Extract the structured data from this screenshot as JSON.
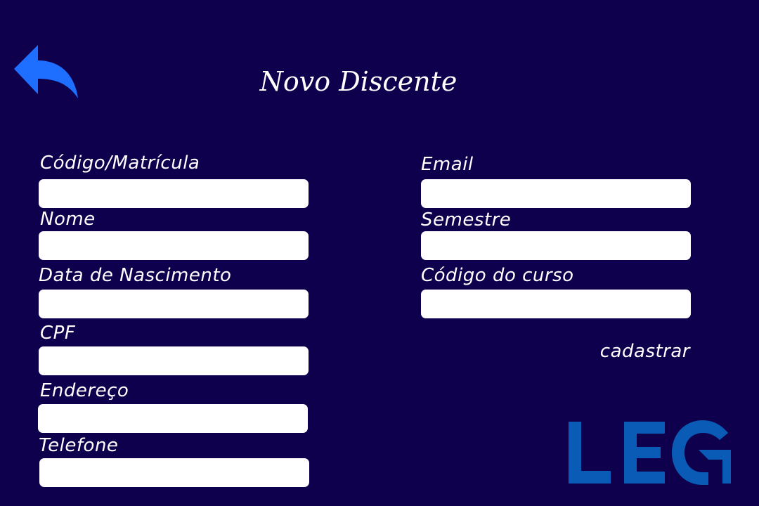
{
  "header": {
    "title": "Novo Discente",
    "back_icon": "back-arrow-icon"
  },
  "form": {
    "left_fields": [
      {
        "label": "Código/Matrícula",
        "value": ""
      },
      {
        "label": "Nome",
        "value": ""
      },
      {
        "label": "Data de Nascimento",
        "value": ""
      },
      {
        "label": "CPF",
        "value": ""
      },
      {
        "label": "Endereço",
        "value": ""
      },
      {
        "label": "Telefone",
        "value": ""
      }
    ],
    "right_fields": [
      {
        "label": "Email",
        "value": ""
      },
      {
        "label": "Semestre",
        "value": ""
      },
      {
        "label": "Código do curso",
        "value": ""
      }
    ],
    "submit_label": "cadastrar"
  },
  "logo": {
    "text": "LEG",
    "color": "#0a5bb5"
  },
  "colors": {
    "background": "#0f004e",
    "accent": "#1e6fff",
    "input_background": "#ffffff"
  }
}
